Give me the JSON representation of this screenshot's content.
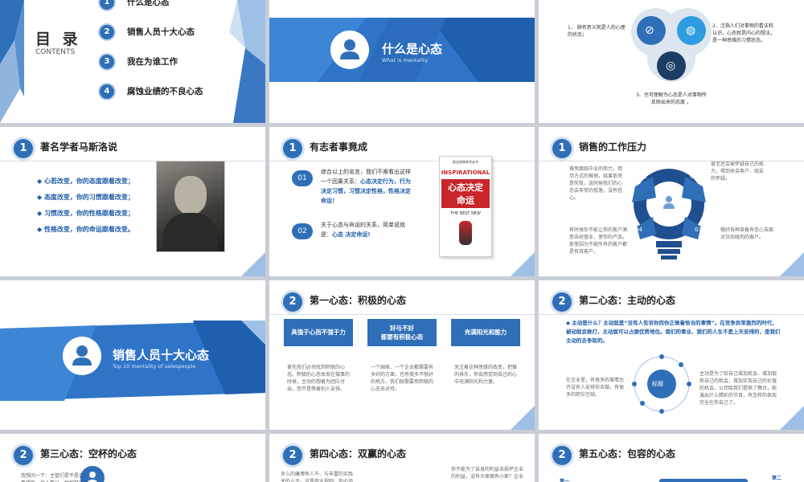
{
  "toc": {
    "title": "目 录",
    "subtitle": "CONTENTS",
    "items": [
      {
        "num": "1",
        "label": "什么是心态"
      },
      {
        "num": "2",
        "label": "销售人员十大心态"
      },
      {
        "num": "3",
        "label": "我在为谁工作"
      },
      {
        "num": "4",
        "label": "腐蚀业绩的不良心态"
      }
    ]
  },
  "s2": {
    "title": "什么是心态",
    "subtitle": "What is mentality"
  },
  "s3": {
    "p1": "1、 顾名思义就是人的心理的状态；",
    "p2": "2、泛指人们对事物的看法和认识，心态就是内心的想法，是一种思维的习惯状态。",
    "p3": "3、也可理解为心态是人对事物所反映出来的态度 。"
  },
  "s4": {
    "num": "1",
    "title": "著名学者马斯洛说",
    "lines": [
      "心若改变，你的态度跟着改变；",
      "态度改变，你的习惯跟着改变；",
      "习惯改变，你的性格跟着改变；",
      "性格改变，你的命运跟着改变。"
    ]
  },
  "s5": {
    "num": "1",
    "title": "有志者事竟成",
    "items": [
      {
        "num": "01",
        "text": "综合以上的名言，我们不难看出这样一个因果关系：",
        "hl": "心态决定行为，行为决定习惯，习惯决定性格，性格决定命运！"
      },
      {
        "num": "02",
        "text": "关于心态与命运的关系，简单说就是：",
        "hl": "心态 决定命运!"
      }
    ],
    "book": {
      "top": "励志经典系列丛书",
      "brand": "INSPIRATIONAL",
      "title1": "心态决定",
      "title2": "命运",
      "sub": "THE BEST NEW"
    }
  },
  "s6": {
    "num": "1",
    "title": "销售的工作压力",
    "q": [
      "01",
      "02",
      "03",
      "04"
    ],
    "t1": "难免面临毕业的努力，用尽方式的推销，结果依然是失败，这时候我们的心态会非常的低落，没有信心。",
    "t2": "甚至还会被怀疑自己的能力，得到来自客户、朋友的怀疑。",
    "t3": "做好各种准备有信心去面对日后碰到的客户。",
    "t4": "有时候你不能让你的客户满意去经营业，使你的产品。那里因为不能所有的客户都是有效客户。"
  },
  "s7": {
    "title": "销售人员十大心态",
    "subtitle": "Top 10 mentality of salespeople"
  },
  "s8": {
    "num": "2",
    "title": "第一心态：积极的心态",
    "boxes": [
      "具强于心而不强于力",
      "好与不好\n都要有积极心态",
      "充满阳光和能力"
    ],
    "t1": "首先我们必须找到积极的心态。积极的心态体现在做事的时候，主动的想着为团队付出，而不是等着别人安排。",
    "t2": "一个国家、一个企业都需要有多好的方面，也有很多不够好的地方，我们就需要用积极的心态去对待。",
    "t3": "关注着这种思维的改变，把推的排斥，你会感觉到自己的心中充满阳光和力量。"
  },
  "s9": {
    "num": "2",
    "title": "第二心态：主动的心态",
    "lead": "主动是什么？主动就是“没有人告诉你而你正做着恰当的事情”。在竞争异常激烈的时代，被动就会挨打，主动就可以占据优势地位。我们的事业、我们的人生不是上天安排的，是我们主动的去争取的。",
    "hub": "标题",
    "left": "在企业里，有很多的事情也许没有人安排你去做，有很多的职位空缺。",
    "right": "主动是为了给自己增加机会、增加锻炼自己的机会，增加实现自己的价值的机会。公司给我们提供了舞台，能演出什么精彩的节目，有怎样的表现完全在你自己了。"
  },
  "s10": {
    "num": "2",
    "title": "第三心态：空杯的心态",
    "t": "我想问一下：主管们是不是会希望每一个人都以一种积极的心态"
  },
  "s11": {
    "num": "2",
    "title": "第四心态：双赢的心态",
    "t1": "多么的康博有人干、与丰富的实践关的人干，这是商业规则。你必须站在",
    "t2": "你不能为了自身的利益去损坏企业的利益，没有大家哪有小家？企业"
  },
  "s12": {
    "num": "2",
    "title": "第五心态：包容的心态",
    "tagL": "第一",
    "tagR": "第二"
  }
}
